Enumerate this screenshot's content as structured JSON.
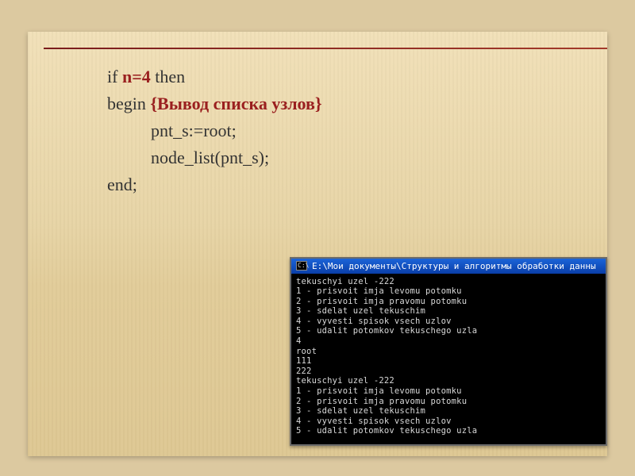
{
  "code": {
    "line1_pre": "if ",
    "line1_hl": "n=4",
    "line1_post": " then",
    "line2_pre": "begin ",
    "line2_hl": "{Вывод списка узлов}",
    "line3": "pnt_s:=root;",
    "line4": "node_list(pnt_s);",
    "line5": "end;"
  },
  "terminal": {
    "icon_text": "C:\\",
    "title": "E:\\Мои документы\\Структуры и алгоритмы обработки данны",
    "lines": [
      "tekuschyi uzel -222",
      "1 - prisvoit imja levomu potomku",
      "2 - prisvoit imja pravomu potomku",
      "3 - sdelat uzel tekuschim",
      "4 - vyvesti spisok vsech uzlov",
      "5 - udalit potomkov tekuschego uzla",
      "4",
      "root",
      "111",
      "222",
      "tekuschyi uzel -222",
      "1 - prisvoit imja levomu potomku",
      "2 - prisvoit imja pravomu potomku",
      "3 - sdelat uzel tekuschim",
      "4 - vyvesti spisok vsech uzlov",
      "5 - udalit potomkov tekuschego uzla"
    ]
  }
}
